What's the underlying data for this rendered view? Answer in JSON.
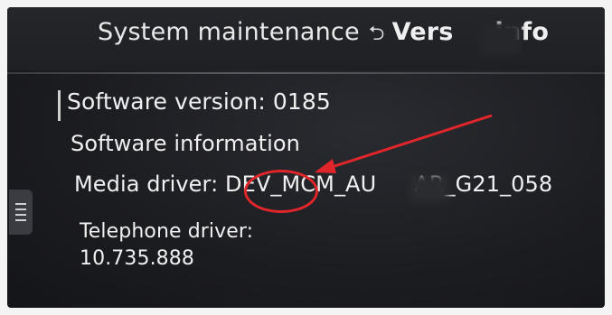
{
  "header": {
    "title": "System maintenance",
    "sub_title_part1": "Vers",
    "sub_title_part2": "info"
  },
  "details": {
    "software_version": "Software version: 0185",
    "software_information": "Software information",
    "media_driver_label": "Media driver: ",
    "media_driver_value_part1": "DEV_MCM_AU",
    "media_driver_value_part2": "AR_G21_058",
    "telephone_driver_label": "Telephone driver:",
    "telephone_driver_value": "10.735.888"
  },
  "annotation": {
    "color": "#e0262b"
  },
  "icons": {
    "back_arrow": "return-arrow-icon",
    "side_menu": "menu-list-icon"
  }
}
